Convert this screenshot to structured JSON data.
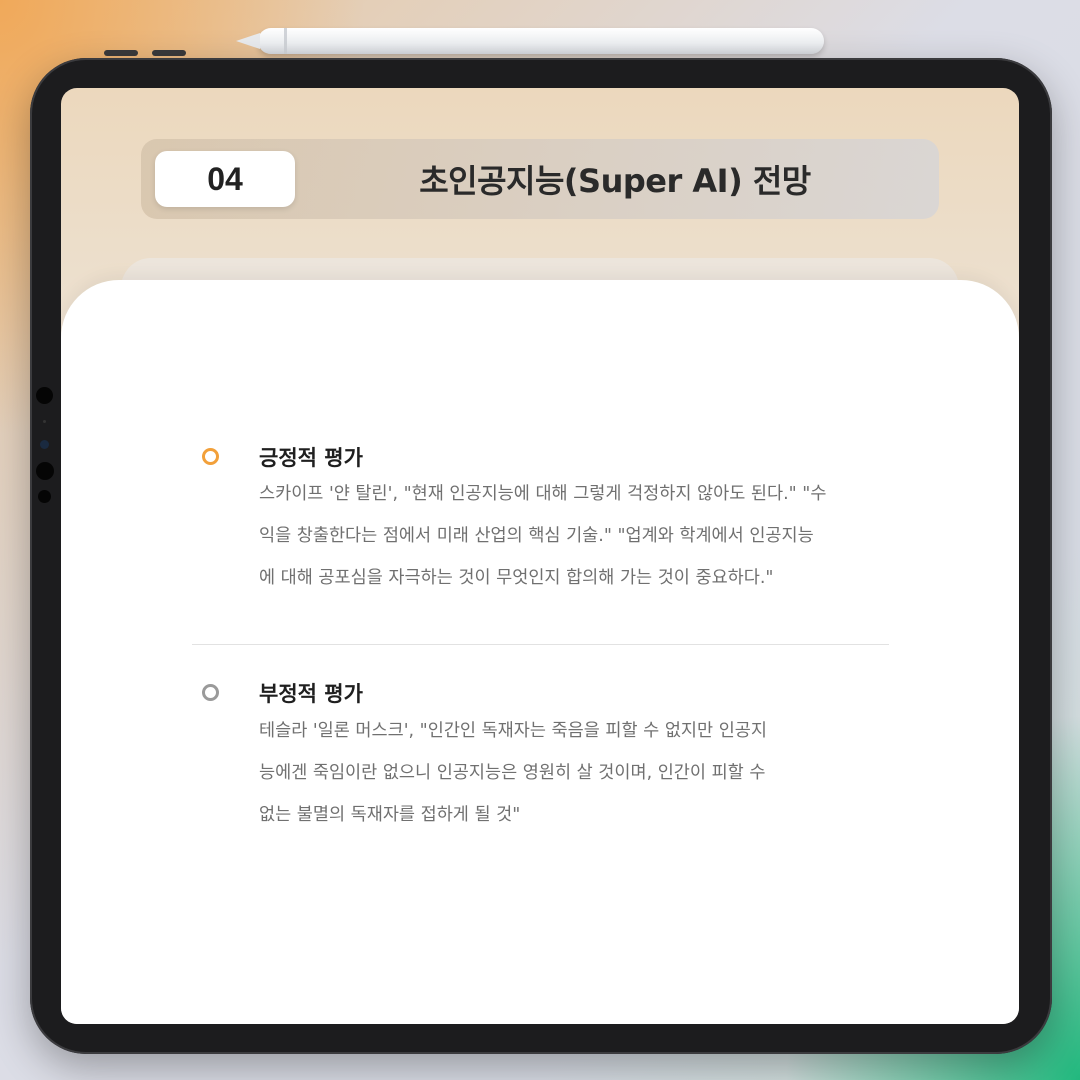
{
  "header": {
    "number": "04",
    "title": "초인공지능(Super AI) 전망"
  },
  "sections": [
    {
      "title": "긍정적 평가",
      "bullet_color": "#f2a03a",
      "lines": [
        "스카이프 '얀 탈린', \"현재 인공지능에 대해 그렇게 걱정하지 않아도 된다.\" \"수",
        "익을 창출한다는 점에서 미래 산업의 핵심 기술.\" \"업계와 학계에서 인공지능",
        "에 대해 공포심을 자극하는 것이 무엇인지 합의해 가는 것이 중요하다.\""
      ]
    },
    {
      "title": "부정적 평가",
      "bullet_color": "#9a9a9a",
      "lines": [
        "테슬라 '일론 머스크', \"인간인 독재자는 죽음을 피할 수 없지만 인공지",
        "능에겐 죽임이란 없으니 인공지능은 영원히 살 것이며, 인간이 피할 수",
        "없는 불멸의 독재자를 접하게 될 것\""
      ]
    }
  ]
}
